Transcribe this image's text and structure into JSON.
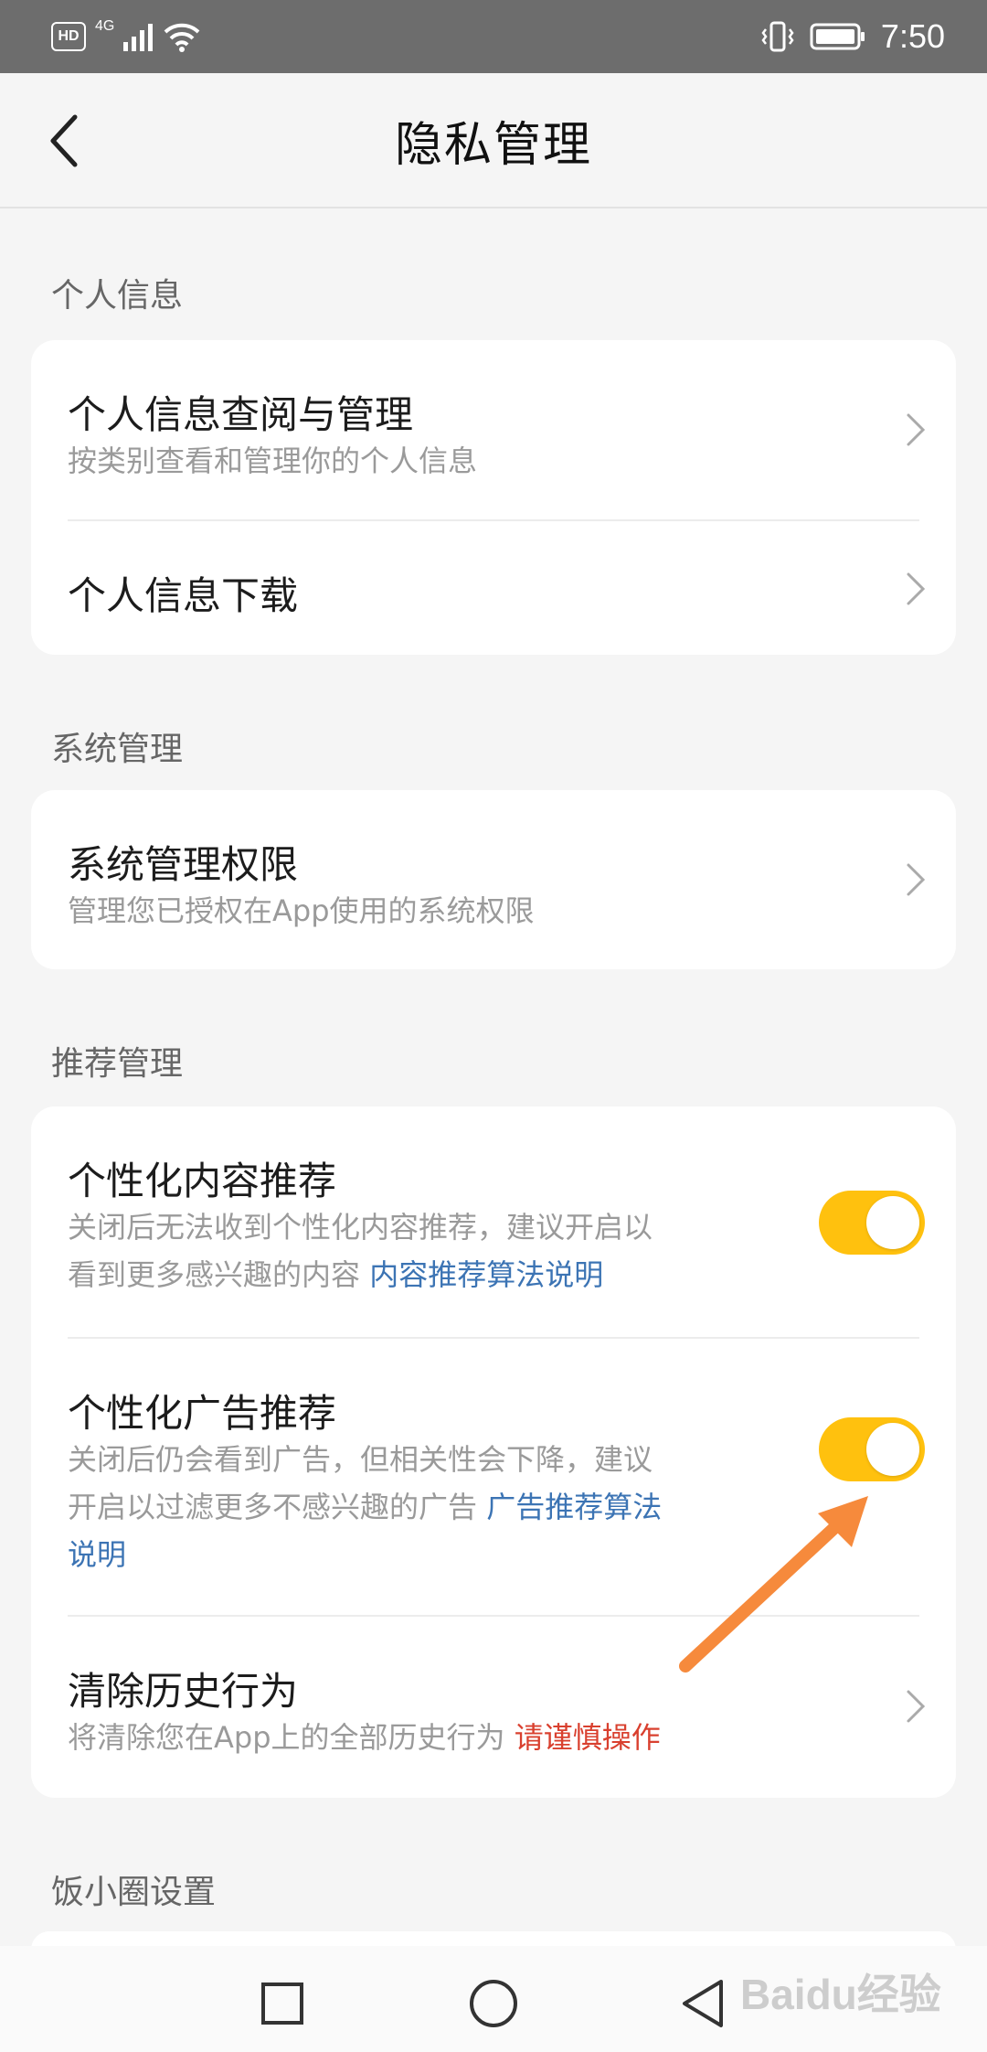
{
  "status_bar": {
    "hd_badge": "HD",
    "network": "4G",
    "time": "7:50",
    "icons": [
      "hd-icon",
      "signal-icon",
      "wifi-icon",
      "vibrate-icon",
      "battery-icon"
    ]
  },
  "header": {
    "title": "隐私管理",
    "back_icon": "chevron-left-icon"
  },
  "sections": [
    {
      "title": "个人信息",
      "items": [
        {
          "title": "个人信息查阅与管理",
          "subtitle": "按类别查看和管理你的个人信息",
          "control": "chevron"
        },
        {
          "title": "个人信息下载",
          "control": "chevron"
        }
      ]
    },
    {
      "title": "系统管理",
      "items": [
        {
          "title": "系统管理权限",
          "subtitle": "管理您已授权在App使用的系统权限",
          "control": "chevron"
        }
      ]
    },
    {
      "title": "推荐管理",
      "items": [
        {
          "title": "个性化内容推荐",
          "subtitle_line1": "关闭后无法收到个性化内容推荐，建议开启以",
          "subtitle_line2": "看到更多感兴趣的内容",
          "link": "内容推荐算法说明",
          "control": "toggle",
          "toggle_on": true
        },
        {
          "title": "个性化广告推荐",
          "subtitle_line1": "关闭后仍会看到广告，但相关性会下降，建议",
          "subtitle_line2": "开启以过滤更多不感兴趣的广告",
          "link_part1": "广告推荐算法",
          "link_part2": "说明",
          "control": "toggle",
          "toggle_on": true
        },
        {
          "title": "清除历史行为",
          "subtitle": "将清除您在App上的全部历史行为",
          "warning": "请谨慎操作",
          "control": "chevron"
        }
      ]
    },
    {
      "title": "饭小圈设置",
      "items": []
    }
  ],
  "bottom_nav": {
    "icons": [
      "recent-apps-icon",
      "home-icon",
      "back-icon"
    ]
  },
  "watermark": "Baidu经验",
  "colors": {
    "toggle_on": "#ffc10e",
    "link": "#3c74b4",
    "warning": "#d9402f",
    "annotation_arrow": "#f68a3c"
  }
}
